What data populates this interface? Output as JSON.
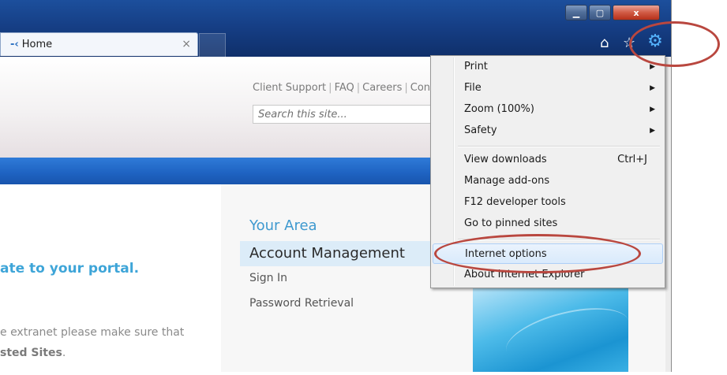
{
  "browser": {
    "tab_title": "Home",
    "tab_close": "×",
    "window_buttons": {
      "minimize": "▁",
      "maximize": "▢",
      "close": "x"
    },
    "toolbar_icons": [
      "home-icon",
      "favorites-star-icon",
      "tools-gear-icon"
    ]
  },
  "page": {
    "top_nav": [
      "Client Support",
      "FAQ",
      "Careers",
      "Con"
    ],
    "search_placeholder": "Search this site...",
    "welcome_fragment": "ate to your portal.",
    "notice_line1": "e extranet please make sure that",
    "notice_line2_bold": "sted Sites",
    "notice_line2_end": ".",
    "your_area": {
      "heading": "Your Area",
      "selected": "Account Management",
      "links": [
        "Sign In",
        "Password Retrieval"
      ]
    }
  },
  "tools_menu": {
    "items": [
      {
        "label": "Print",
        "submenu": true
      },
      {
        "label": "File",
        "submenu": true
      },
      {
        "label": "Zoom (100%)",
        "submenu": true
      },
      {
        "label": "Safety",
        "submenu": true
      },
      {
        "label": "View downloads",
        "shortcut": "Ctrl+J"
      },
      {
        "label": "Manage add-ons"
      },
      {
        "label": "F12 developer tools"
      },
      {
        "label": "Go to pinned sites"
      },
      {
        "label": "Internet options",
        "highlighted": true
      },
      {
        "label": "About Internet Explorer"
      }
    ]
  },
  "colors": {
    "annotation": "#b9473f",
    "accent_blue": "#3e99cf",
    "header_bar": "#1e62c1"
  }
}
